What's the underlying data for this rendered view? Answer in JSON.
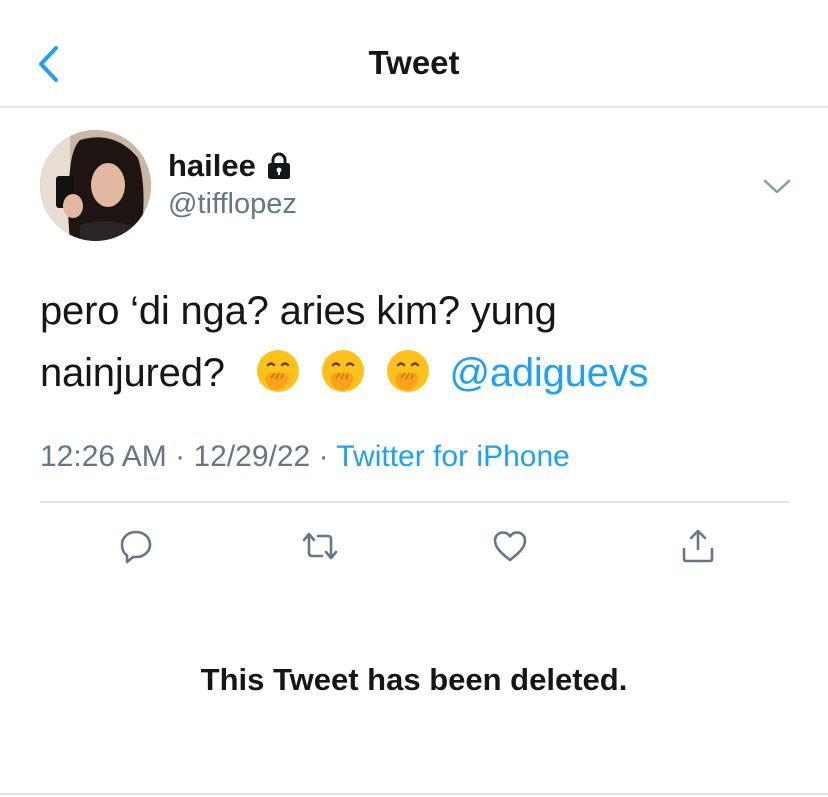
{
  "header": {
    "back_icon": "chevron-left-icon",
    "title": "Tweet"
  },
  "tweet": {
    "author": {
      "display_name": "hailee",
      "protected_icon": "lock-icon",
      "handle": "@tifflopez"
    },
    "menu_icon": "chevron-down-icon",
    "text_line1": "pero ‘di nga? aries kim? yung",
    "text_line2": "nainjured?",
    "emojis": [
      "face-with-hand-over-mouth",
      "face-with-hand-over-mouth",
      "face-with-hand-over-mouth"
    ],
    "mention": "@adiguevs",
    "time": "12:26 AM",
    "date": "12/29/22",
    "separator": "·",
    "source": "Twitter for iPhone"
  },
  "actions": [
    "reply-icon",
    "retweet-icon",
    "like-icon",
    "share-icon"
  ],
  "deleted_notice": "This Tweet has been deleted.",
  "colors": {
    "accent": "#1da1f2",
    "secondary_text": "#657786",
    "primary_text": "#14171a",
    "divider": "#e1e5e9"
  }
}
